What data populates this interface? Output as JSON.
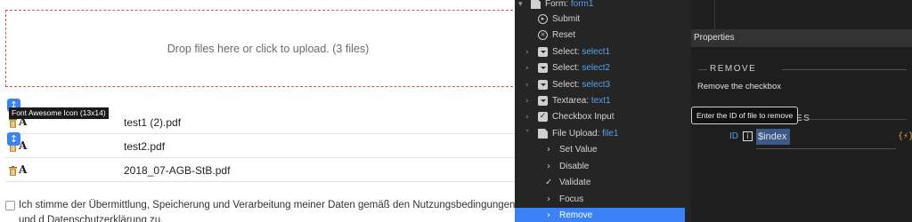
{
  "upload": {
    "dropzone_text": "Drop files here or click to upload. (3 files)",
    "files": [
      {
        "name": "test1 (2).pdf"
      },
      {
        "name": "test2.pdf"
      },
      {
        "name": "2018_07-AGB-StB.pdf"
      }
    ],
    "font_glyph": "A",
    "handle_glyph": "↕",
    "icon_tooltip": "Font Awesome Icon (13x14)",
    "consent_text": "Ich stimme der Übermittlung, Speicherung und Verarbeitung meiner Daten gemäß den Nutzungsbedingungen und d Datenschutzerklärung zu."
  },
  "tree": {
    "form": {
      "type": "Form:",
      "ref": "form1"
    },
    "items": [
      {
        "type": "Submit",
        "ref": "",
        "icon": "play-circle-icon"
      },
      {
        "type": "Reset",
        "ref": "",
        "icon": "x-circle-icon"
      },
      {
        "type": "Select:",
        "ref": "select1",
        "icon": "select-icon"
      },
      {
        "type": "Select:",
        "ref": "select2",
        "icon": "select-icon"
      },
      {
        "type": "Select:",
        "ref": "select3",
        "icon": "select-icon"
      },
      {
        "type": "Textarea:",
        "ref": "text1",
        "icon": "textarea-icon"
      },
      {
        "type": "Checkbox Input",
        "ref": "",
        "icon": "checkbox-icon"
      },
      {
        "type": "File Upload:",
        "ref": "file1",
        "icon": "file-icon"
      }
    ],
    "actions": [
      {
        "label": "Set Value",
        "icon": "chevron-right-icon"
      },
      {
        "label": "Disable",
        "icon": "chevron-right-icon"
      },
      {
        "label": "Validate",
        "icon": "check-icon"
      },
      {
        "label": "Focus",
        "icon": "chevron-right-icon"
      },
      {
        "label": "Remove",
        "icon": "chevron-right-icon"
      }
    ],
    "selected_action": "Remove"
  },
  "properties": {
    "header": "Properties",
    "section_title": "REMOVE",
    "description": "Remove the checkbox",
    "params_title_visible": "ES",
    "id_tooltip": "Enter the ID of file to remove",
    "id_label": "ID",
    "id_value": "$index",
    "expression_icon": "{⚡}"
  },
  "colors": {
    "accent": "#3b82f6",
    "ref_blue": "#5aa0e8",
    "dropzone_border": "#d9534f",
    "tree_bg": "#252526",
    "props_bg": "#1e1e1e"
  }
}
